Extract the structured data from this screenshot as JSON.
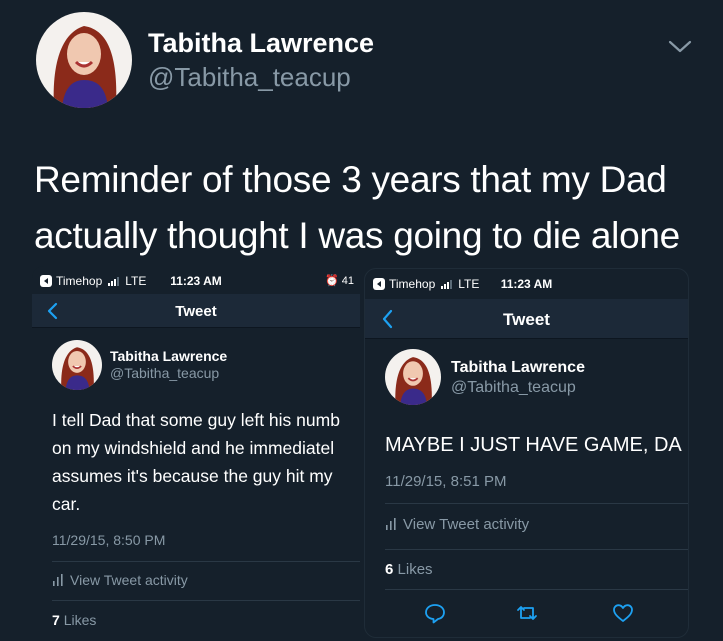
{
  "tweet": {
    "author_name": "Tabitha Lawrence",
    "author_handle": "@Tabitha_teacup",
    "text": "Reminder of those 3 years that my Dad actually thought I was going to die alone"
  },
  "screenshots": [
    {
      "status": {
        "carrier": "Timehop",
        "network": "LTE",
        "time": "11:23 AM",
        "right": "41"
      },
      "nav_title": "Tweet",
      "author_name": "Tabitha Lawrence",
      "author_handle": "@Tabitha_teacup",
      "text": "I tell Dad that some guy left his numb\non my windshield and he immediatel\nassumes it's because the guy hit my\ncar.",
      "date": "11/29/15, 8:50 PM",
      "activity": "View Tweet activity",
      "likes_count": "7",
      "likes_label": "Likes"
    },
    {
      "status": {
        "carrier": "Timehop",
        "network": "LTE",
        "time": "11:23 AM"
      },
      "nav_title": "Tweet",
      "author_name": "Tabitha Lawrence",
      "author_handle": "@Tabitha_teacup",
      "text": "MAYBE I JUST HAVE GAME, DA",
      "date": "11/29/15, 8:51 PM",
      "activity": "View Tweet activity",
      "likes_count": "6",
      "likes_label": "Likes"
    }
  ],
  "colors": {
    "background": "#15202b",
    "secondary_text": "#8899a6",
    "accent": "#1da1f2"
  }
}
